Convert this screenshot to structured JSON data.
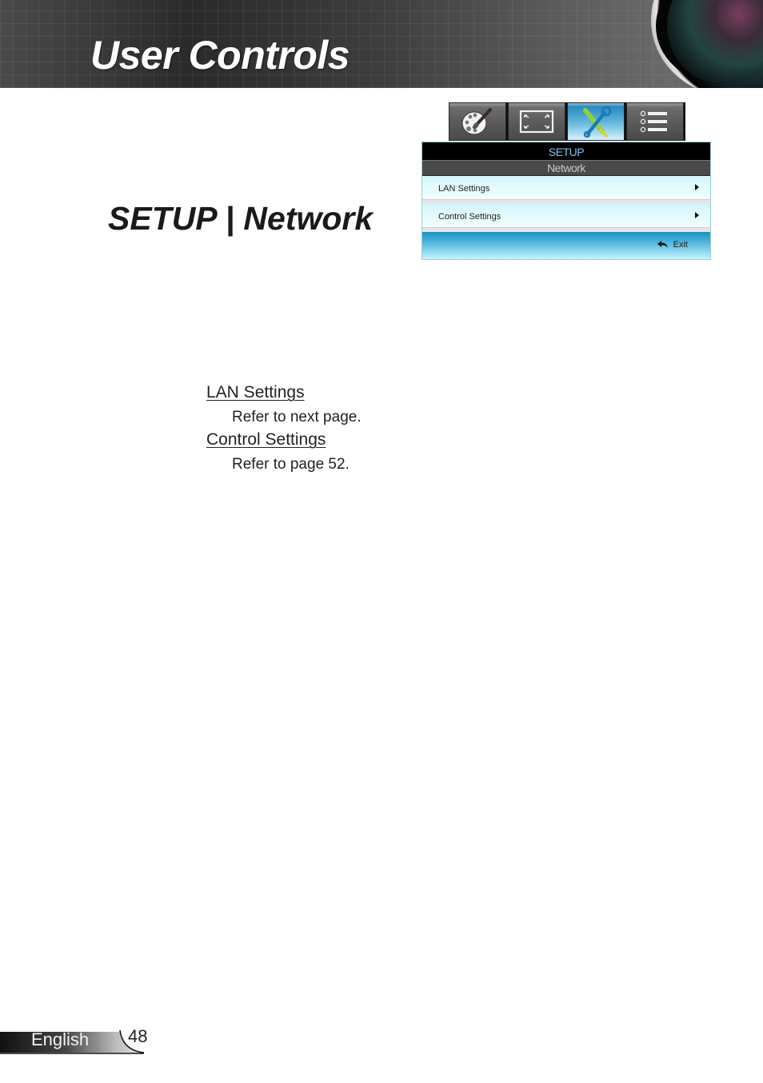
{
  "header": {
    "title": "User Controls"
  },
  "section": {
    "title": "SETUP | Network"
  },
  "osd": {
    "tabs": [
      {
        "name": "image",
        "icon": "palette-icon",
        "active": false
      },
      {
        "name": "display",
        "icon": "resize-screen-icon",
        "active": false
      },
      {
        "name": "setup",
        "icon": "tools-icon",
        "active": true
      },
      {
        "name": "options",
        "icon": "list-icon",
        "active": false
      }
    ],
    "menu_title": "SETUP",
    "submenu_title": "Network",
    "items": [
      {
        "label": "LAN Settings",
        "icon": "chevron-right-icon"
      },
      {
        "label": "Control Settings",
        "icon": "chevron-right-icon"
      }
    ],
    "exit_label": "Exit",
    "colors": {
      "menu_title": "#7fc6ee",
      "active_tab": "#2a8bbd",
      "exit_bar": "#1d93c4"
    }
  },
  "entries": [
    {
      "title": "LAN Settings",
      "description": "Refer to next page."
    },
    {
      "title": "Control Settings",
      "description": "Refer to page 52."
    }
  ],
  "footer": {
    "language": "English",
    "page_number": "48"
  }
}
